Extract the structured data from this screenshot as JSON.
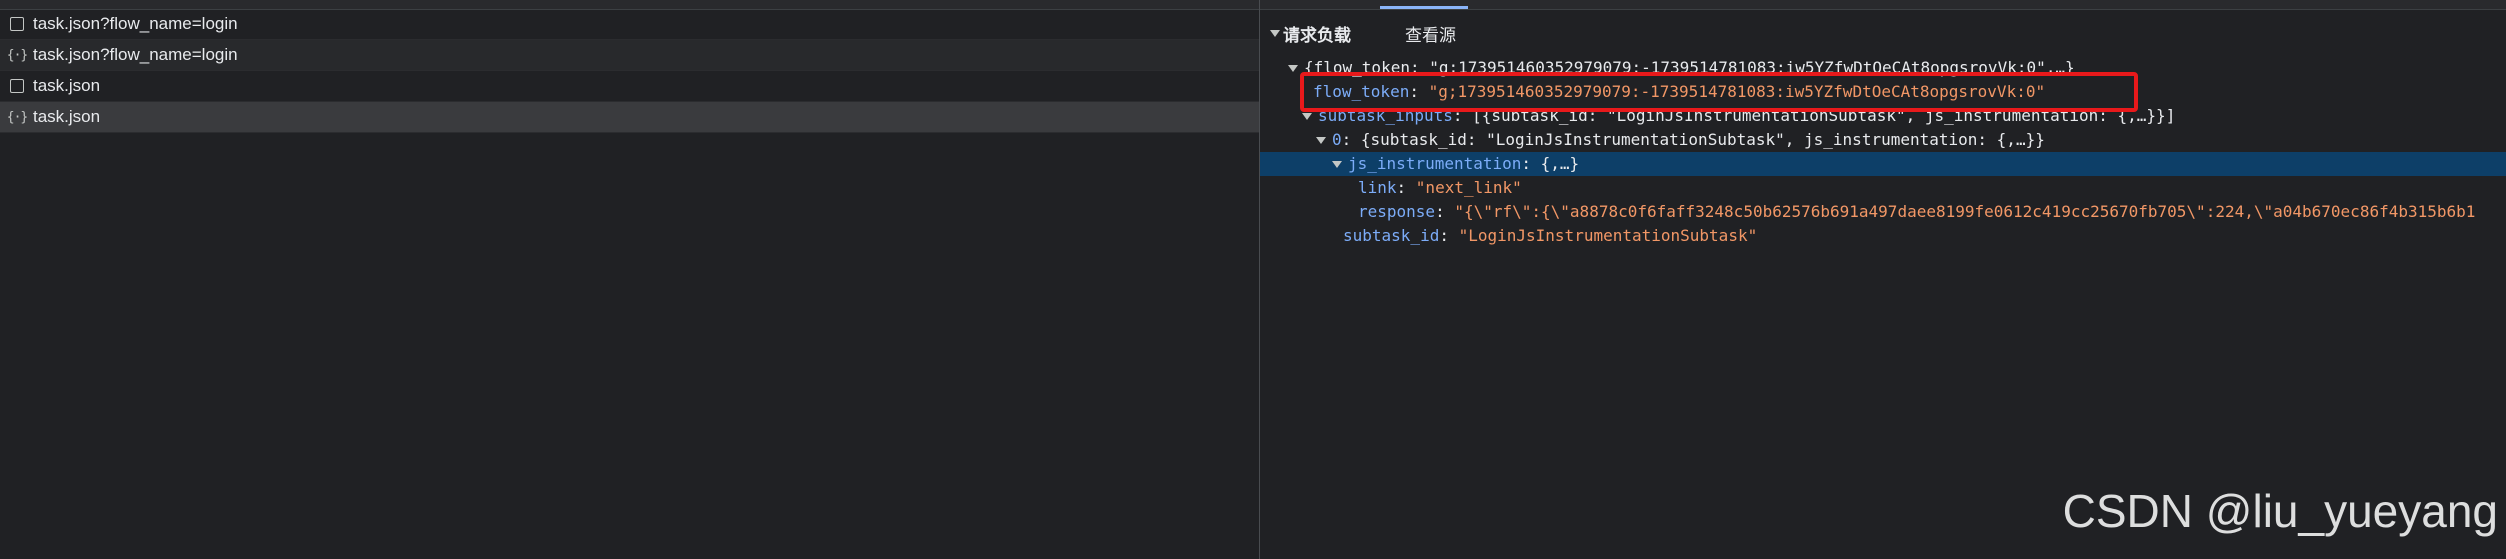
{
  "requests": [
    {
      "name": "task.json?flow_name=login",
      "icon": "doc-icon"
    },
    {
      "name": "task.json?flow_name=login",
      "icon": "json-braces-icon"
    },
    {
      "name": "task.json",
      "icon": "doc-icon"
    },
    {
      "name": "task.json",
      "icon": "json-braces-icon",
      "selected": true
    }
  ],
  "payload": {
    "section_title": "请求负载",
    "view_source": "查看源",
    "root_summary": "{flow_token: \"g;173951460352979079:-1739514781083:iw5YZfwDtOeCAt8opgsrovVk:0\",…}",
    "flow_token_key": "flow_token",
    "flow_token_value": "\"g;173951460352979079:-1739514781083:iw5YZfwDtOeCAt8opgsrovVk:0\"",
    "subtask_inputs_key": "subtask_inputs",
    "subtask_inputs_summary": "[{subtask_id: \"LoginJsInstrumentationSubtask\", js_instrumentation: {,…}}]",
    "item0_key": "0",
    "item0_summary": "{subtask_id: \"LoginJsInstrumentationSubtask\", js_instrumentation: {,…}}",
    "js_instr_key": "js_instrumentation",
    "js_instr_summary": "{,…}",
    "link_key": "link",
    "link_value": "\"next_link\"",
    "response_key": "response",
    "response_value": "\"{\\\"rf\\\":{\\\"a8878c0f6faff3248c50b62576b691a497daee8199fe0612c419cc25670fb705\\\":224,\\\"a04b670ec86f4b315b6b1",
    "subtask_id_key": "subtask_id",
    "subtask_id_value": "\"LoginJsInstrumentationSubtask\""
  },
  "watermark": "CSDN @liu_yueyang"
}
